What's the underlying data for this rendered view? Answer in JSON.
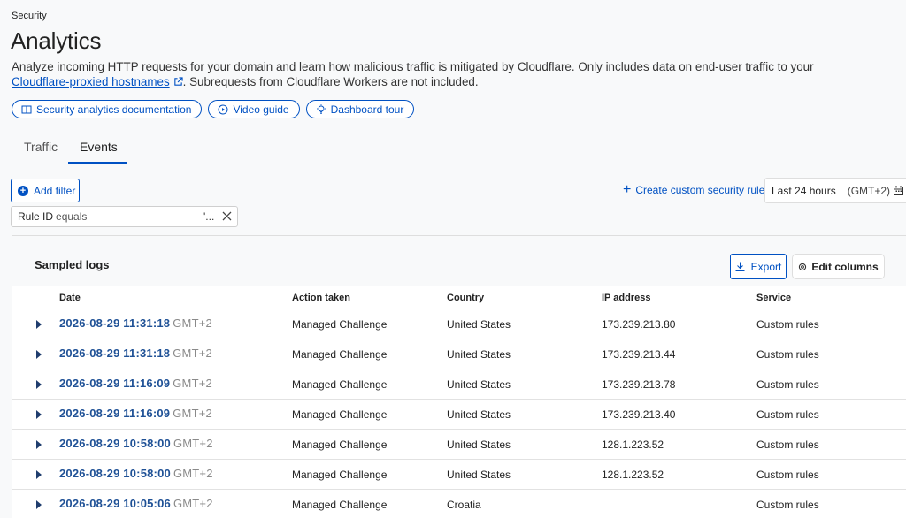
{
  "breadcrumb": "Security",
  "page_title": "Analytics",
  "description": {
    "part1": "Analyze incoming HTTP requests for your domain and learn how malicious traffic is mitigated by Cloudflare. Only includes data on end-user traffic to your",
    "link": "Cloudflare-proxied hostnames",
    "part2": ". Subrequests from Cloudflare Workers are not included."
  },
  "resource_links": [
    {
      "label": "Security analytics documentation",
      "icon": "book-icon"
    },
    {
      "label": "Video guide",
      "icon": "play-circle-icon"
    },
    {
      "label": "Dashboard tour",
      "icon": "lightbulb-icon"
    }
  ],
  "tabs": [
    {
      "label": "Traffic",
      "active": false
    },
    {
      "label": "Events",
      "active": true
    }
  ],
  "filters": {
    "add_filter_label": "Add filter",
    "active_filter": {
      "field": "Rule ID",
      "operator": "equals",
      "value": "'..."
    }
  },
  "actions": {
    "create_rule_label": "Create custom security rule",
    "time_range": "Last 24 hours",
    "timezone": "(GMT+2)"
  },
  "sampled_logs": {
    "title": "Sampled logs",
    "export_label": "Export",
    "edit_columns_label": "Edit columns",
    "columns": [
      "Date",
      "Action taken",
      "Country",
      "IP address",
      "Service"
    ],
    "rows": [
      {
        "date": "2026-08-29 11:31:18",
        "tz": "GMT+2",
        "action": "Managed Challenge",
        "country": "United States",
        "ip": "173.239.213.80",
        "service": "Custom rules"
      },
      {
        "date": "2026-08-29 11:31:18",
        "tz": "GMT+2",
        "action": "Managed Challenge",
        "country": "United States",
        "ip": "173.239.213.44",
        "service": "Custom rules"
      },
      {
        "date": "2026-08-29 11:16:09",
        "tz": "GMT+2",
        "action": "Managed Challenge",
        "country": "United States",
        "ip": "173.239.213.78",
        "service": "Custom rules"
      },
      {
        "date": "2026-08-29 11:16:09",
        "tz": "GMT+2",
        "action": "Managed Challenge",
        "country": "United States",
        "ip": "173.239.213.40",
        "service": "Custom rules"
      },
      {
        "date": "2026-08-29 10:58:00",
        "tz": "GMT+2",
        "action": "Managed Challenge",
        "country": "United States",
        "ip": "128.1.223.52",
        "service": "Custom rules"
      },
      {
        "date": "2026-08-29 10:58:00",
        "tz": "GMT+2",
        "action": "Managed Challenge",
        "country": "United States",
        "ip": "128.1.223.52",
        "service": "Custom rules"
      },
      {
        "date": "2026-08-29 10:05:06",
        "tz": "GMT+2",
        "action": "Managed Challenge",
        "country": "Croatia",
        "ip": "",
        "service": "Custom rules"
      }
    ]
  },
  "colors": {
    "accent": "#0051c3",
    "date_link": "#1f5196",
    "background": "#f8f9fa"
  }
}
